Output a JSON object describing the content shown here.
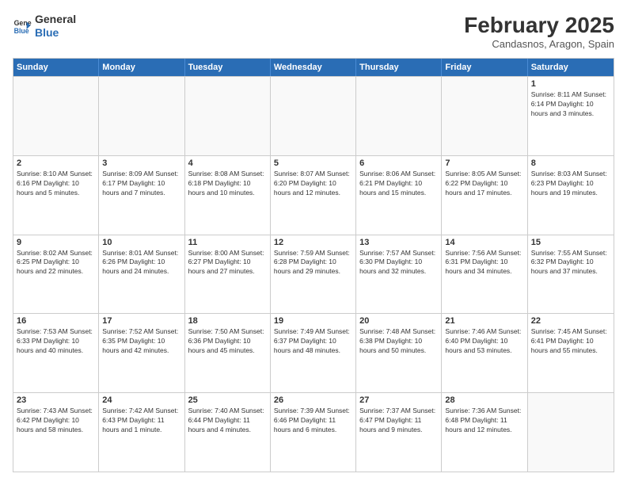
{
  "logo": {
    "line1": "General",
    "line2": "Blue"
  },
  "title": "February 2025",
  "location": "Candasnos, Aragon, Spain",
  "header": {
    "days": [
      "Sunday",
      "Monday",
      "Tuesday",
      "Wednesday",
      "Thursday",
      "Friday",
      "Saturday"
    ]
  },
  "weeks": [
    [
      {
        "day": "",
        "info": ""
      },
      {
        "day": "",
        "info": ""
      },
      {
        "day": "",
        "info": ""
      },
      {
        "day": "",
        "info": ""
      },
      {
        "day": "",
        "info": ""
      },
      {
        "day": "",
        "info": ""
      },
      {
        "day": "1",
        "info": "Sunrise: 8:11 AM\nSunset: 6:14 PM\nDaylight: 10 hours\nand 3 minutes."
      }
    ],
    [
      {
        "day": "2",
        "info": "Sunrise: 8:10 AM\nSunset: 6:16 PM\nDaylight: 10 hours\nand 5 minutes."
      },
      {
        "day": "3",
        "info": "Sunrise: 8:09 AM\nSunset: 6:17 PM\nDaylight: 10 hours\nand 7 minutes."
      },
      {
        "day": "4",
        "info": "Sunrise: 8:08 AM\nSunset: 6:18 PM\nDaylight: 10 hours\nand 10 minutes."
      },
      {
        "day": "5",
        "info": "Sunrise: 8:07 AM\nSunset: 6:20 PM\nDaylight: 10 hours\nand 12 minutes."
      },
      {
        "day": "6",
        "info": "Sunrise: 8:06 AM\nSunset: 6:21 PM\nDaylight: 10 hours\nand 15 minutes."
      },
      {
        "day": "7",
        "info": "Sunrise: 8:05 AM\nSunset: 6:22 PM\nDaylight: 10 hours\nand 17 minutes."
      },
      {
        "day": "8",
        "info": "Sunrise: 8:03 AM\nSunset: 6:23 PM\nDaylight: 10 hours\nand 19 minutes."
      }
    ],
    [
      {
        "day": "9",
        "info": "Sunrise: 8:02 AM\nSunset: 6:25 PM\nDaylight: 10 hours\nand 22 minutes."
      },
      {
        "day": "10",
        "info": "Sunrise: 8:01 AM\nSunset: 6:26 PM\nDaylight: 10 hours\nand 24 minutes."
      },
      {
        "day": "11",
        "info": "Sunrise: 8:00 AM\nSunset: 6:27 PM\nDaylight: 10 hours\nand 27 minutes."
      },
      {
        "day": "12",
        "info": "Sunrise: 7:59 AM\nSunset: 6:28 PM\nDaylight: 10 hours\nand 29 minutes."
      },
      {
        "day": "13",
        "info": "Sunrise: 7:57 AM\nSunset: 6:30 PM\nDaylight: 10 hours\nand 32 minutes."
      },
      {
        "day": "14",
        "info": "Sunrise: 7:56 AM\nSunset: 6:31 PM\nDaylight: 10 hours\nand 34 minutes."
      },
      {
        "day": "15",
        "info": "Sunrise: 7:55 AM\nSunset: 6:32 PM\nDaylight: 10 hours\nand 37 minutes."
      }
    ],
    [
      {
        "day": "16",
        "info": "Sunrise: 7:53 AM\nSunset: 6:33 PM\nDaylight: 10 hours\nand 40 minutes."
      },
      {
        "day": "17",
        "info": "Sunrise: 7:52 AM\nSunset: 6:35 PM\nDaylight: 10 hours\nand 42 minutes."
      },
      {
        "day": "18",
        "info": "Sunrise: 7:50 AM\nSunset: 6:36 PM\nDaylight: 10 hours\nand 45 minutes."
      },
      {
        "day": "19",
        "info": "Sunrise: 7:49 AM\nSunset: 6:37 PM\nDaylight: 10 hours\nand 48 minutes."
      },
      {
        "day": "20",
        "info": "Sunrise: 7:48 AM\nSunset: 6:38 PM\nDaylight: 10 hours\nand 50 minutes."
      },
      {
        "day": "21",
        "info": "Sunrise: 7:46 AM\nSunset: 6:40 PM\nDaylight: 10 hours\nand 53 minutes."
      },
      {
        "day": "22",
        "info": "Sunrise: 7:45 AM\nSunset: 6:41 PM\nDaylight: 10 hours\nand 55 minutes."
      }
    ],
    [
      {
        "day": "23",
        "info": "Sunrise: 7:43 AM\nSunset: 6:42 PM\nDaylight: 10 hours\nand 58 minutes."
      },
      {
        "day": "24",
        "info": "Sunrise: 7:42 AM\nSunset: 6:43 PM\nDaylight: 11 hours\nand 1 minute."
      },
      {
        "day": "25",
        "info": "Sunrise: 7:40 AM\nSunset: 6:44 PM\nDaylight: 11 hours\nand 4 minutes."
      },
      {
        "day": "26",
        "info": "Sunrise: 7:39 AM\nSunset: 6:46 PM\nDaylight: 11 hours\nand 6 minutes."
      },
      {
        "day": "27",
        "info": "Sunrise: 7:37 AM\nSunset: 6:47 PM\nDaylight: 11 hours\nand 9 minutes."
      },
      {
        "day": "28",
        "info": "Sunrise: 7:36 AM\nSunset: 6:48 PM\nDaylight: 11 hours\nand 12 minutes."
      },
      {
        "day": "",
        "info": ""
      }
    ]
  ]
}
